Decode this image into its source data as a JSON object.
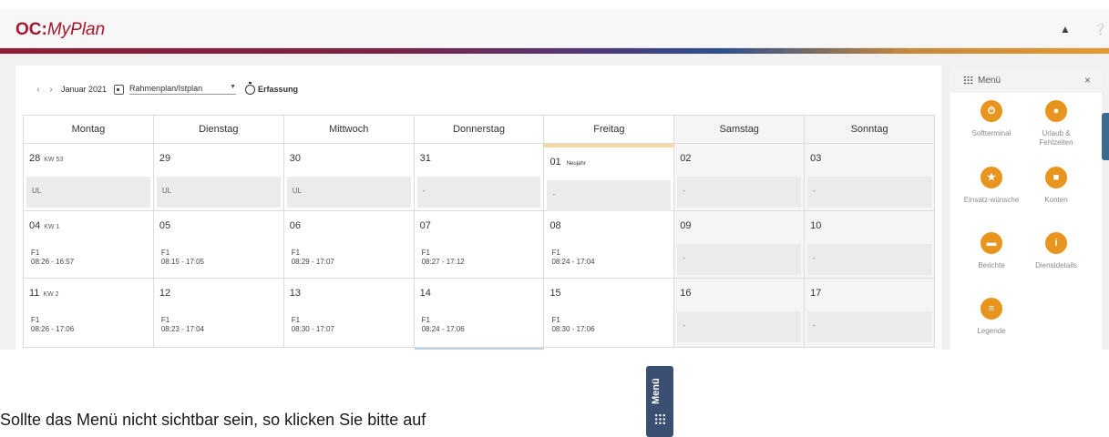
{
  "app": {
    "logo_prefix": "OC:",
    "logo_suffix": "MyPlan",
    "user_icon": "user-icon",
    "help_icon": "help-icon"
  },
  "toolbar": {
    "prev": "‹",
    "next": "›",
    "month": "Januar 2021",
    "plan_select": "Rahmenplan/Istplan",
    "capture_label": "Erfassung"
  },
  "calendar": {
    "headers": [
      "Montag",
      "Dienstag",
      "Mittwoch",
      "Donnerstag",
      "Freitag",
      "Samstag",
      "Sonntag"
    ],
    "weeks": [
      {
        "kw": "KW 53",
        "days": [
          {
            "num": "28",
            "entry": "UL"
          },
          {
            "num": "29",
            "entry": "UL"
          },
          {
            "num": "30",
            "entry": "UL"
          },
          {
            "num": "31",
            "entry": "-"
          },
          {
            "num": "01",
            "holiday": "Neujahr",
            "entry": "-"
          },
          {
            "num": "02",
            "entry": "-"
          },
          {
            "num": "03",
            "entry": "-"
          }
        ]
      },
      {
        "kw": "KW 1",
        "days": [
          {
            "num": "04",
            "shift": "F1",
            "time": "08:26 - 16:57"
          },
          {
            "num": "05",
            "shift": "F1",
            "time": "08:15 - 17:05"
          },
          {
            "num": "06",
            "shift": "F1",
            "time": "08:29 - 17:07"
          },
          {
            "num": "07",
            "shift": "F1",
            "time": "08:27 - 17:12"
          },
          {
            "num": "08",
            "shift": "F1",
            "time": "08:24 - 17:04"
          },
          {
            "num": "09",
            "entry": "-"
          },
          {
            "num": "10",
            "entry": "-"
          }
        ]
      },
      {
        "kw": "KW 2",
        "days": [
          {
            "num": "11",
            "shift": "F1",
            "time": "08:26 - 17:06"
          },
          {
            "num": "12",
            "shift": "F1",
            "time": "08:23 - 17:04"
          },
          {
            "num": "13",
            "shift": "F1",
            "time": "08:30 - 17:07"
          },
          {
            "num": "14",
            "shift": "F1",
            "time": "08:24 - 17:06"
          },
          {
            "num": "15",
            "shift": "F1",
            "time": "08:30 - 17:06"
          },
          {
            "num": "16",
            "entry": "-"
          },
          {
            "num": "17",
            "entry": "-"
          }
        ]
      }
    ]
  },
  "menu": {
    "title": "Menü",
    "close": "×",
    "items": [
      {
        "label": "Softterminal",
        "icon": "stopwatch-icon"
      },
      {
        "label": "Urlaub & Fehlzeiten",
        "icon": "person-icon"
      },
      {
        "label": "Einsatz-wünsche",
        "icon": "star-icon"
      },
      {
        "label": "Konten",
        "icon": "document-icon"
      },
      {
        "label": "Berichte",
        "icon": "printer-icon"
      },
      {
        "label": "Dienstdetails",
        "icon": "info-icon"
      },
      {
        "label": "Legende",
        "icon": "list-icon"
      }
    ]
  },
  "footer": {
    "text": "Sollte das Menü nicht sichtbar sein, so klicken Sie bitte auf",
    "button_label": "Menü"
  },
  "colors": {
    "brand": "#a3162c",
    "accent": "#e8951f",
    "menu_button": "#3b4f73"
  }
}
